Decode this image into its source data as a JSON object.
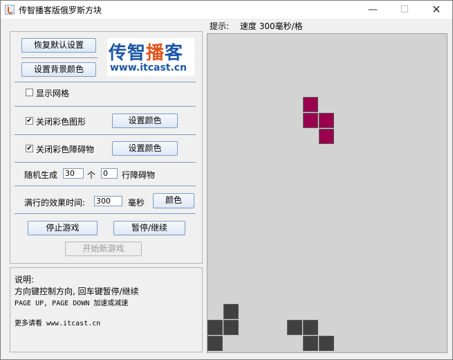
{
  "window": {
    "title": "传智播客版俄罗斯方块",
    "min_glyph": "—",
    "max_glyph": "☐",
    "close_glyph": "✕"
  },
  "controls": {
    "restore_defaults": "恢复默认设置",
    "set_bg_color": "设置背景颜色",
    "logo_cn_1": "传智",
    "logo_cn_2": "播",
    "logo_cn_3": "客",
    "logo_url": "www.itcast.cn",
    "show_grid": {
      "label": "显示网格",
      "checked": false
    },
    "disable_color_shape": {
      "label": "关闭彩色图形",
      "checked": true,
      "button": "设置颜色"
    },
    "disable_color_obstacle": {
      "label": "关闭彩色障碍物",
      "checked": true,
      "button": "设置颜色"
    },
    "random_generate": {
      "prefix": "随机生成",
      "count": "30",
      "mid": "个",
      "rows": "0",
      "suffix": "行障碍物"
    },
    "fullline_effect": {
      "prefix": "满行的效果时间:",
      "value": "300",
      "unit": "毫秒",
      "button": "颜色"
    },
    "stop_game": "停止游戏",
    "pause_resume": "暂停/继续",
    "new_game": "开始新游戏"
  },
  "help": {
    "title": "说明:",
    "line1": "方向键控制方向, 回车键暂停/继续",
    "line2": "PAGE UP, PAGE DOWN 加速或减速",
    "line3": "更多请看 www.itcast.cn"
  },
  "status": {
    "label": "提示:",
    "speed": "速度 300毫秒/格"
  },
  "colors": {
    "active_piece": "#99004d",
    "obstacle": "#404040",
    "board_bg": "#d3d3d3"
  },
  "board": {
    "cols": 15,
    "active_piece": [
      [
        6,
        4
      ],
      [
        6,
        5
      ],
      [
        7,
        5
      ],
      [
        7,
        6
      ]
    ],
    "obstacles": [
      [
        1,
        17
      ],
      [
        0,
        18
      ],
      [
        1,
        18
      ],
      [
        0,
        19
      ],
      [
        5,
        18
      ],
      [
        6,
        18
      ],
      [
        6,
        19
      ],
      [
        7,
        19
      ]
    ]
  }
}
